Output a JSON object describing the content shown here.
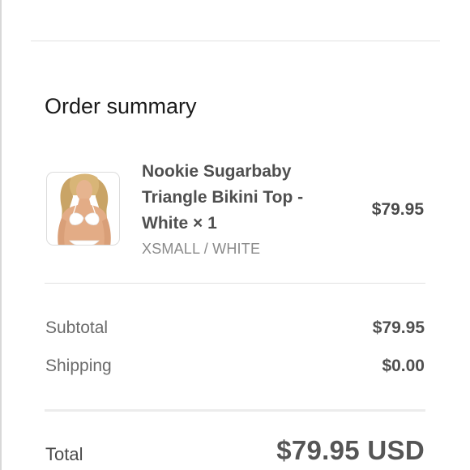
{
  "order_summary": {
    "title": "Order summary",
    "item": {
      "name": "Nookie Sugarbaby Triangle Bikini Top - White × 1",
      "variant": "XSMALL / WHITE",
      "price": "$79.95",
      "thumbnail_icon": "product-photo-icon"
    },
    "subtotal": {
      "label": "Subtotal",
      "value": "$79.95"
    },
    "shipping": {
      "label": "Shipping",
      "value": "$0.00"
    },
    "total": {
      "label": "Total",
      "value": "$79.95 USD"
    }
  },
  "colors": {
    "divider": "#e1e1e1",
    "label": "#6b6b6b",
    "value": "#4f4f4f",
    "muted": "#8a8a8a"
  }
}
